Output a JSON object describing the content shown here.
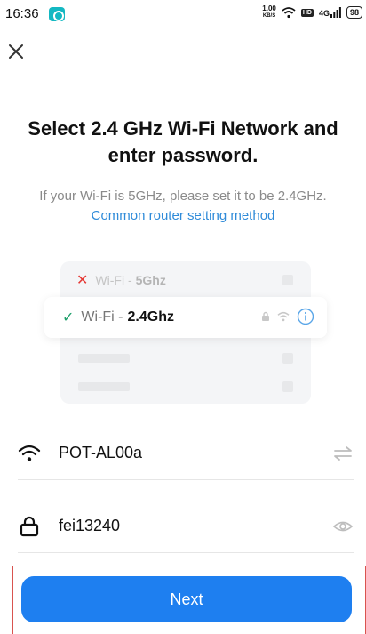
{
  "status_bar": {
    "time": "16:36",
    "net_speed_value": "1.00",
    "net_speed_unit": "KB/S",
    "hd_badge": "HD",
    "network_type": "4G",
    "battery": "98"
  },
  "header": {
    "title": "Select 2.4 GHz Wi-Fi Network and enter password.",
    "hint": "If your Wi-Fi is 5GHz, please set it to be 2.4GHz.",
    "link": "Common router setting method"
  },
  "illustration": {
    "row_5g_label": "Wi-Fi -",
    "row_5g_band": "5Ghz",
    "row_24g_label": "Wi-Fi -",
    "row_24g_band": "2.4Ghz"
  },
  "form": {
    "ssid_value": "POT-AL00a",
    "password_value": "fei13240"
  },
  "footer": {
    "next_label": "Next"
  },
  "colors": {
    "accent": "#1e7ff0",
    "link": "#2f8bd9",
    "error": "#e53935",
    "success": "#1fa06c"
  }
}
